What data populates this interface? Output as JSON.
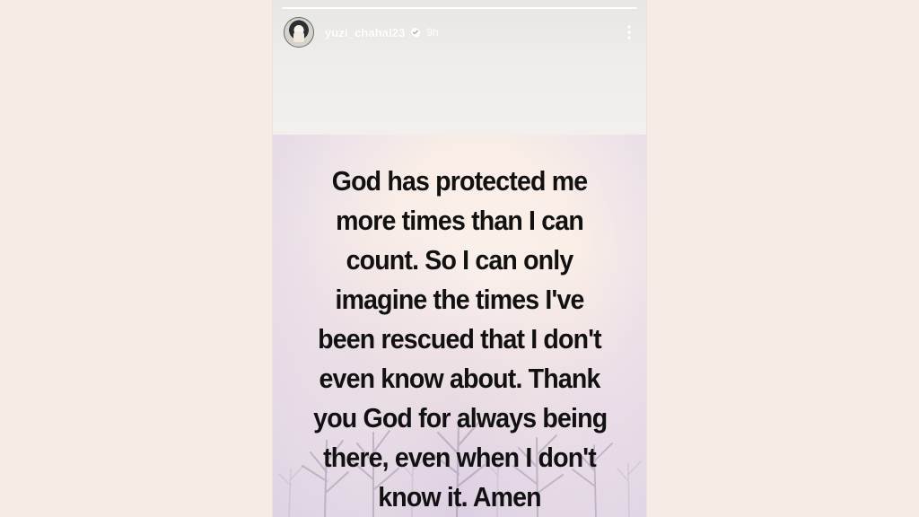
{
  "story": {
    "progress": 1.0,
    "username": "yuzi_chahal23",
    "time": "9h",
    "more_icon": "more-vertical-icon",
    "verified_icon": "verified-badge-icon",
    "quote_lines": [
      "God has protected me",
      "more times than I can",
      "count. So I can only",
      "imagine the times I've",
      "been rescued that I don't",
      "even know about. Thank",
      "you God for always being",
      "there, even when I don't",
      "know it. Amen"
    ]
  },
  "colors": {
    "page_background": "#f5ece3",
    "text": "#111111",
    "header_text": "#ffffff"
  }
}
